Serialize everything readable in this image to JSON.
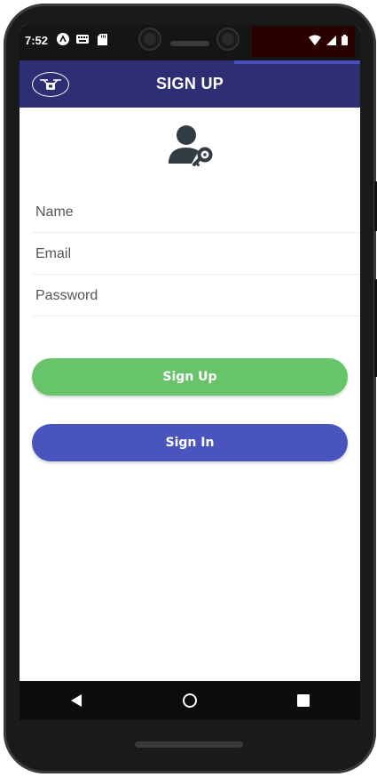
{
  "status_bar": {
    "time": "7:52",
    "left_icons": [
      "app-notification-icon",
      "keyboard-icon",
      "sd-card-icon"
    ],
    "right_icons": [
      "wifi-icon",
      "cellular-signal-icon",
      "battery-icon"
    ]
  },
  "app_bar": {
    "title": "SIGN UP",
    "logo_icon": "drone-logo-icon",
    "background": "#2e2f72"
  },
  "form": {
    "avatar_icon": "user-key-icon",
    "name_placeholder": "Name",
    "email_placeholder": "Email",
    "password_placeholder": "Password",
    "name_value": "",
    "email_value": "",
    "password_value": ""
  },
  "buttons": {
    "sign_up_label": "Sign Up",
    "sign_up_color": "#67c46b",
    "sign_in_label": "Sign In",
    "sign_in_color": "#4955bd"
  },
  "nav": {
    "back_icon": "back-triangle-icon",
    "home_icon": "home-circle-icon",
    "recents_icon": "recents-square-icon"
  }
}
